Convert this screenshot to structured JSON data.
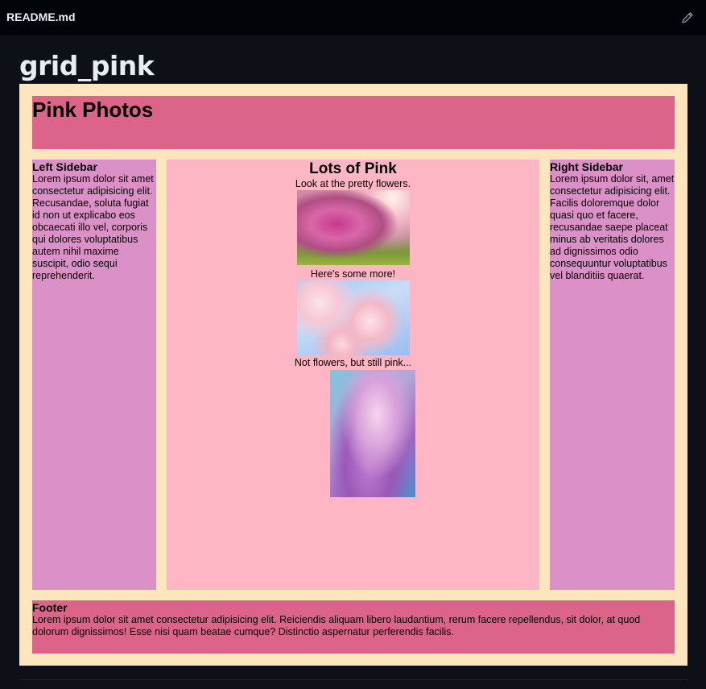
{
  "file": {
    "name": "README.md",
    "edit_icon": "pencil-icon"
  },
  "readme": {
    "title": "grid_pink"
  },
  "page": {
    "header": {
      "title": "Pink Photos"
    },
    "left_sidebar": {
      "title": "Left Sidebar",
      "text": "Lorem ipsum dolor sit amet consectetur adipisicing elit. Recusandae, soluta fugiat id non ut explicabo eos obcaecati illo vel, corporis qui dolores voluptatibus autem nihil maxime suscipit, odio sequi reprehenderit."
    },
    "main": {
      "title": "Lots of Pink",
      "captions": [
        "Look at the pretty flowers.",
        "Here's some more!",
        "Not flowers, but still pink..."
      ]
    },
    "right_sidebar": {
      "title": "Right Sidebar",
      "text": "Lorem ipsum dolor sit, amet consectetur adipisicing elit. Facilis doloremque dolor quasi quo et facere, recusandae saepe placeat minus ab veritatis dolores ad dignissimos odio consequuntur voluptatibus vel blanditiis quaerat."
    },
    "footer": {
      "title": "Footer",
      "text": "Lorem ipsum dolor sit amet consectetur adipisicing elit. Reiciendis aliquam libero laudantium, rerum facere repellendus, sit dolor, at quod dolorum dignissimos! Esse nisi quam beatae cumque? Distinctio aspernatur perferendis facilis."
    }
  },
  "colors": {
    "page_background": "#0d1117",
    "grid_background": "#fde6bd",
    "header_footer": "#dc6389",
    "sidebars": "#db91c7",
    "main": "#feb5c4"
  }
}
